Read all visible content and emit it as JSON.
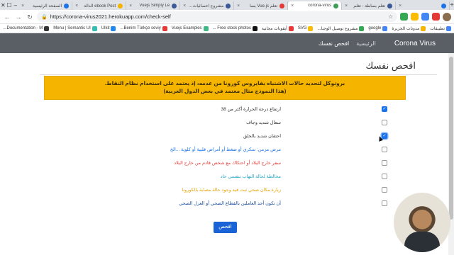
{
  "browser": {
    "tabs": [
      {
        "label": "الصفحة الرئيسية",
        "icon_color": "#1a73e8",
        "active": false
      },
      {
        "label": "ebook Post الدالة",
        "icon_color": "#f4b400",
        "active": false
      },
      {
        "label": "Vuejs Simply Le",
        "icon_color": "#3b5998",
        "active": false
      },
      {
        "label": "مشروع احصائيات ك",
        "icon_color": "#3b5998",
        "active": false
      },
      {
        "label": "تعلم Vue.js بسا",
        "icon_color": "#e53935",
        "active": false
      },
      {
        "label": "corona-virus",
        "icon_color": "#3f9d5a",
        "active": true
      },
      {
        "label": "تعلم بساطة - تعلم",
        "icon_color": "#3b5998",
        "active": false
      },
      {
        "label": "",
        "icon_color": "#1a73e8",
        "active": false
      }
    ],
    "new_tab": "+",
    "window_min": "–",
    "window_max": "☐",
    "window_close": "✕",
    "url": "https://corona-virus2021.herokuapp.com/check-self",
    "back": "←",
    "forward": "→",
    "reload": "↻",
    "star": "☆",
    "bookmarks": [
      {
        "label": "تطبيقات",
        "color": "#4285f4"
      },
      {
        "label": "مدونات الجزيرة",
        "color": "#f4b400"
      },
      {
        "label": "google",
        "color": "#4285f4"
      },
      {
        "label": "مشروع توصيل الوجبا...",
        "color": "#34a853"
      },
      {
        "label": "SVG",
        "color": "#fbbc05"
      },
      {
        "label": "أيقونات مجانية",
        "color": "#e53935"
      },
      {
        "label": "Free stock photos ...",
        "color": "#111111"
      },
      {
        "label": "Vuejs Examples",
        "color": "#41b883"
      },
      {
        "label": "Benim Türkçe seviy...",
        "color": "#e53935"
      },
      {
        "label": "Ulkit",
        "color": "#1e87f0"
      },
      {
        "label": "Menu | Semantic UI",
        "color": "#35bdb2"
      },
      {
        "label": "Documentation - M...",
        "color": "#333333"
      }
    ]
  },
  "site": {
    "brand": "Corona Virus",
    "nav": [
      {
        "label": "الرئيسية",
        "active": false
      },
      {
        "label": "افحص نفسك",
        "active": true
      }
    ],
    "page_title": "افحص نفسك",
    "alert_line1": "بروتوكل لتحديد حالات الاشتباه بفايروس كورونا من عدمه، إذ يعتمد على استخدام نظام النقاط.",
    "alert_line2": "(هذا النموذج مثال معتمد في بعض الدول العربية)",
    "questions": [
      {
        "label": "ارتفاع درجة الحرارة أكثر من 38",
        "checked": true,
        "color": "#333333"
      },
      {
        "label": "سعال شديد وجاف",
        "checked": false,
        "color": "#333333"
      },
      {
        "label": "احتقان شديد بالحلق",
        "checked": true,
        "color": "#333333"
      },
      {
        "label": "مرض مزمن: سكري أو ضغط أو أمراض قلبية أو كلوية ...الخ",
        "checked": false,
        "color": "#1a73e8"
      },
      {
        "label": "سفر خارج البلاد أو احتكاك مع شخص قادم من خارج البلاد",
        "checked": false,
        "color": "#e53935"
      },
      {
        "label": "مخالطة لحالة التهاب تنفسي حاد",
        "checked": false,
        "color": "#26a6c7"
      },
      {
        "label": "زيارة مكان صحي ثبت فيه وجود حالة مصابة بالكورونا",
        "checked": false,
        "color": "#e8a400"
      },
      {
        "label": "أن تكون أحد العاملين بالقطاع الصحي أو العزل الصحي",
        "checked": false,
        "color": "#1a4fa0"
      }
    ],
    "submit_label": "افحص"
  },
  "colors": {
    "navbar": "#5a5f66",
    "alert_bg": "#f4b400",
    "button": "#1a63d6"
  }
}
